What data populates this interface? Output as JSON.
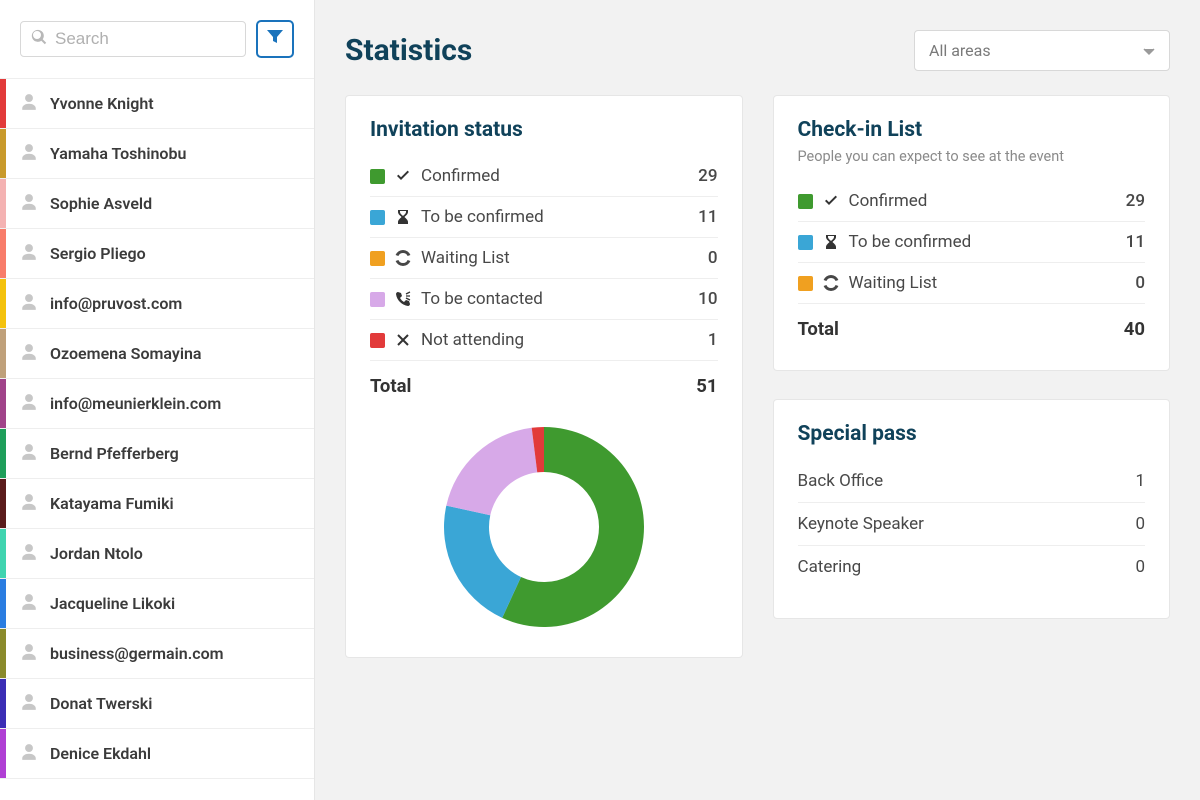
{
  "search": {
    "placeholder": "Search"
  },
  "people": [
    {
      "name": "Yvonne Knight",
      "color": "#e23a3a"
    },
    {
      "name": "Yamaha Toshinobu",
      "color": "#c99a2b"
    },
    {
      "name": "Sophie Asveld",
      "color": "#f4b2b2"
    },
    {
      "name": "Sergio Pliego",
      "color": "#f87c6a"
    },
    {
      "name": "info@pruvost.com",
      "color": "#f4c20d"
    },
    {
      "name": "Ozoemena Somayina",
      "color": "#bfa07a"
    },
    {
      "name": "info@meunierklein.com",
      "color": "#a04389"
    },
    {
      "name": "Bernd Pfefferberg",
      "color": "#1e9e5a"
    },
    {
      "name": "Katayama Fumiki",
      "color": "#5a1b1b"
    },
    {
      "name": "Jordan Ntolo",
      "color": "#3fd4af"
    },
    {
      "name": "Jacqueline Likoki",
      "color": "#2a7de1"
    },
    {
      "name": "business@germain.com",
      "color": "#8a8a2b"
    },
    {
      "name": "Donat Twerski",
      "color": "#3b2db5"
    },
    {
      "name": "Denice Ekdahl",
      "color": "#b03fd4"
    }
  ],
  "header": {
    "title": "Statistics",
    "area_selected": "All areas"
  },
  "invitation": {
    "title": "Invitation status",
    "total_label": "Total",
    "total": 51,
    "items": [
      {
        "label": "Confirmed",
        "value": 29,
        "color": "#3f9a2f",
        "icon": "check"
      },
      {
        "label": "To be confirmed",
        "value": 11,
        "color": "#3aa6d6",
        "icon": "hourglass"
      },
      {
        "label": "Waiting List",
        "value": 0,
        "color": "#f0a020",
        "icon": "spinner"
      },
      {
        "label": "To be contacted",
        "value": 10,
        "color": "#d7a9e8",
        "icon": "phone"
      },
      {
        "label": "Not attending",
        "value": 1,
        "color": "#e23a3a",
        "icon": "x"
      }
    ]
  },
  "checkin": {
    "title": "Check-in List",
    "subtitle": "People you can expect to see at the event",
    "total_label": "Total",
    "total": 40,
    "items": [
      {
        "label": "Confirmed",
        "value": 29,
        "color": "#3f9a2f",
        "icon": "check"
      },
      {
        "label": "To be confirmed",
        "value": 11,
        "color": "#3aa6d6",
        "icon": "hourglass"
      },
      {
        "label": "Waiting List",
        "value": 0,
        "color": "#f0a020",
        "icon": "spinner"
      }
    ]
  },
  "special_pass": {
    "title": "Special pass",
    "items": [
      {
        "label": "Back Office",
        "value": 1
      },
      {
        "label": "Keynote Speaker",
        "value": 0
      },
      {
        "label": "Catering",
        "value": 0
      }
    ]
  },
  "chart_data": {
    "type": "pie",
    "title": "Invitation status",
    "categories": [
      "Confirmed",
      "To be confirmed",
      "Waiting List",
      "To be contacted",
      "Not attending"
    ],
    "values": [
      29,
      11,
      0,
      10,
      1
    ],
    "colors": [
      "#3f9a2f",
      "#3aa6d6",
      "#f0a020",
      "#d7a9e8",
      "#e23a3a"
    ],
    "inner_radius_ratio": 0.55
  }
}
